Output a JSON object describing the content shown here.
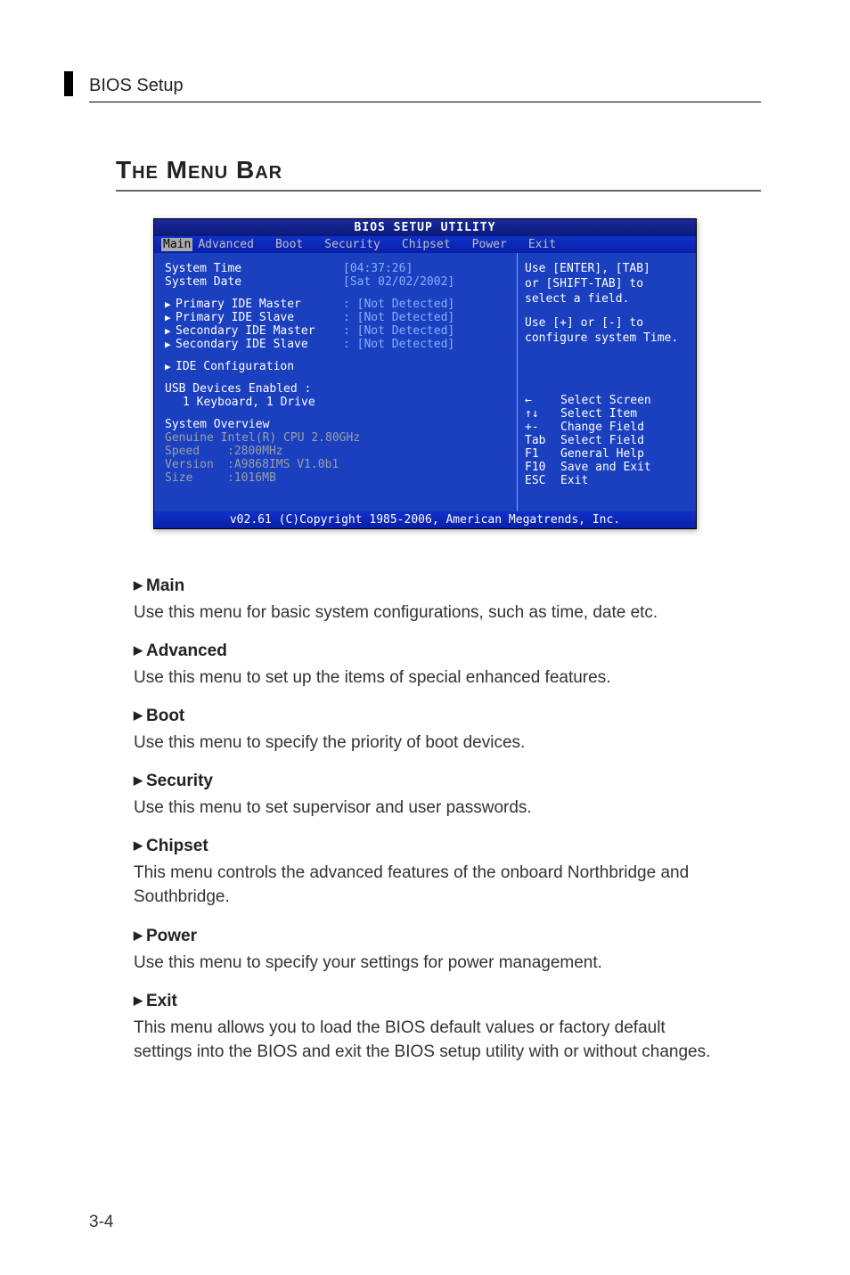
{
  "header": {
    "section": "BIOS Setup"
  },
  "title": "The Menu Bar",
  "bios": {
    "title": "BIOS SETUP UTILITY",
    "tabs": [
      "Main",
      "Advanced",
      "Boot",
      "Security",
      "Chipset",
      "Power",
      "Exit"
    ],
    "selected_tab": "Main",
    "left": {
      "system_time_label": "System Time",
      "system_time_value": "[04:37:26]",
      "system_date_label": "System Date",
      "system_date_value": "[Sat 02/02/2002]",
      "pim_label": "Primary IDE Master",
      "pim_value": ": [Not Detected]",
      "pis_label": "Primary IDE Slave",
      "pis_value": ": [Not Detected]",
      "sim_label": "Secondary IDE Master",
      "sim_value": ": [Not Detected]",
      "sis_label": "Secondary IDE Slave",
      "sis_value": ": [Not Detected]",
      "ide_conf": "IDE Configuration",
      "usb_en": "USB Devices Enabled :",
      "usb_en_val": "1 Keyboard, 1 Drive",
      "sys_ov": "System Overview",
      "cpu": "Genuine Intel(R) CPU 2.80GHz",
      "speed_l": "Speed",
      "speed_v": ":2800MHz",
      "ver_l": "Version",
      "ver_v": ":A9868IMS V1.0b1",
      "size_l": "Size",
      "size_v": ":1016MB"
    },
    "right": {
      "h1": "Use [ENTER], [TAB]",
      "h2": "or [SHIFT-TAB] to",
      "h3": "select a field.",
      "h4": "Use [+] or [-] to",
      "h5": "configure system Time.",
      "k1k": "←",
      "k1t": "Select Screen",
      "k2k": "↑↓",
      "k2t": "Select Item",
      "k3k": "+-",
      "k3t": "Change Field",
      "k4k": "Tab",
      "k4t": "Select Field",
      "k5k": "F1",
      "k5t": "General Help",
      "k6k": "F10",
      "k6t": "Save and Exit",
      "k7k": "ESC",
      "k7t": "Exit"
    },
    "footer": "v02.61 (C)Copyright 1985-2006, American Megatrends, Inc."
  },
  "descriptions": [
    {
      "head": "Main",
      "body": "Use this menu for basic system configurations, such as time, date etc."
    },
    {
      "head": "Advanced",
      "body": "Use this menu to set up the items of special enhanced features."
    },
    {
      "head": "Boot",
      "body": "Use this menu to specify the priority of boot devices."
    },
    {
      "head": "Security",
      "body": "Use this menu to set supervisor and user passwords."
    },
    {
      "head": "Chipset",
      "body": "This menu controls the advanced features of the onboard Northbridge and Southbridge."
    },
    {
      "head": "Power",
      "body": "Use this menu to specify your settings for power management."
    },
    {
      "head": "Exit",
      "body": "This menu allows you to load the BIOS default values or factory default settings into the BIOS and exit the BIOS setup utility with or without changes."
    }
  ],
  "page_number": "3-4"
}
